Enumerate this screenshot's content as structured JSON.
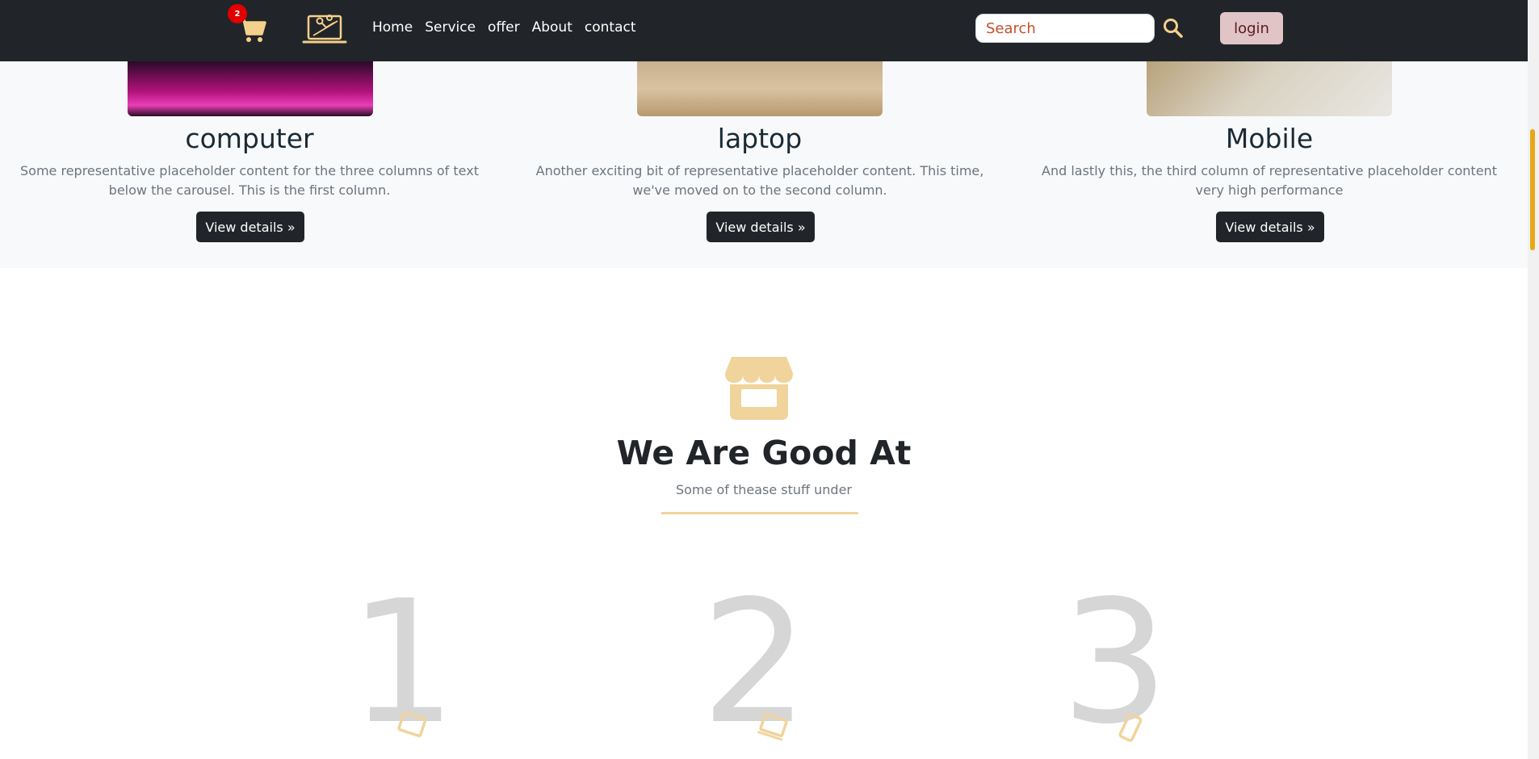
{
  "navbar": {
    "cart_count": "2",
    "links": [
      "Home",
      "Service",
      "offer",
      "About",
      "contact"
    ],
    "search_placeholder": "Search",
    "login_label": "login"
  },
  "cards": [
    {
      "title": "computer",
      "text": "Some representative placeholder content for the three columns of text below the carousel. This is the first column.",
      "button": "View details »"
    },
    {
      "title": "laptop",
      "text": "Another exciting bit of representative placeholder content. This time, we've moved on to the second column.",
      "button": "View details »"
    },
    {
      "title": "Mobile",
      "text": "And lastly this, the third column of representative placeholder content very high performance",
      "button": "View details »"
    }
  ],
  "good_at": {
    "title": "We Are Good At",
    "subtitle": "Some of thease stuff under"
  },
  "numbers": [
    "1",
    "2",
    "3"
  ],
  "colors": {
    "navbar_bg": "#212529",
    "accent": "#f0d49c",
    "cart_icon": "#f5d08c",
    "badge": "#e00000",
    "login_bg": "#e0c4c6",
    "scroll_thumb": "#e6a817"
  },
  "icons": {
    "cart": "shopping-cart-icon",
    "logo": "laptop-logo-icon",
    "search": "magnifier-icon",
    "store": "store-icon",
    "device": "device-icon"
  }
}
